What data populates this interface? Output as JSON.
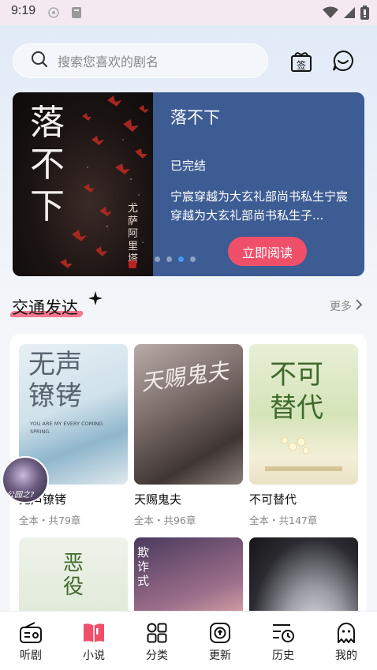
{
  "status_bar": {
    "time": "9:19"
  },
  "search": {
    "placeholder": "搜索您喜欢的剧名"
  },
  "header_icons": [
    {
      "name": "gift-icon",
      "glyph": "签"
    },
    {
      "name": "chat-icon"
    }
  ],
  "banner": {
    "cover": {
      "title_chars": [
        "落",
        "不",
        "下"
      ],
      "author": "尤萨阿里塔"
    },
    "title": "落不下",
    "status": "已完结",
    "description": "宁宸穿越为大玄礼部尚书私生宁宸穿越为大玄礼部尚书私生子...",
    "read_button": "立即阅读",
    "dots_total": 4,
    "dots_active": 3
  },
  "section": {
    "title": "交通发达",
    "more": "更多"
  },
  "books": [
    {
      "name": "无声镣铐",
      "meta": "全本・共79章",
      "cover_text": "无声镣铐",
      "cover_sub": "YOU ARE MY EVERY COMING SPRING."
    },
    {
      "name": "天赐鬼夫",
      "meta": "全本・共96章",
      "cover_text": "天赐鬼夫"
    },
    {
      "name": "不可替代",
      "meta": "全本・共147章",
      "cover_text": "不可替代"
    },
    {
      "name": "",
      "meta": "",
      "cover_text": "恶役"
    },
    {
      "name": "",
      "meta": "",
      "cover_text": "欺诈式"
    },
    {
      "name": "",
      "meta": "",
      "cover_text": ""
    }
  ],
  "float_avatar_caption": "公园之?",
  "nav": [
    {
      "label": "听剧",
      "icon": "radio-icon"
    },
    {
      "label": "小说",
      "icon": "book-icon",
      "active": true
    },
    {
      "label": "分类",
      "icon": "category-icon"
    },
    {
      "label": "更新",
      "icon": "update-icon"
    },
    {
      "label": "历史",
      "icon": "history-icon"
    },
    {
      "label": "我的",
      "icon": "ghost-icon"
    }
  ],
  "colors": {
    "accent": "#f04f6a",
    "banner_bg": "#3c5c93",
    "dot_active": "#4a9af2"
  }
}
